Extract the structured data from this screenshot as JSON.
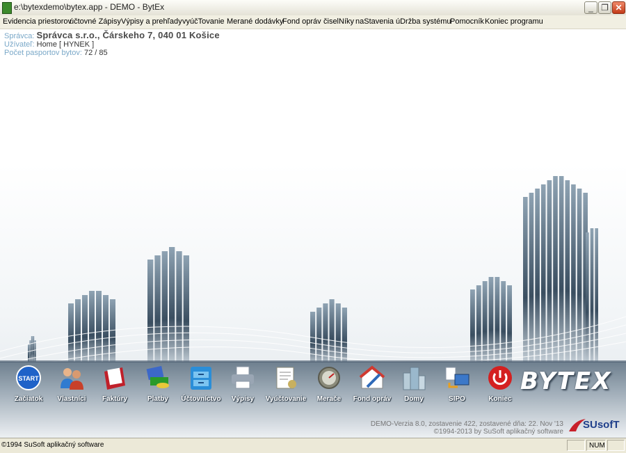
{
  "window": {
    "title": "e:\\bytexdemo\\bytex.app - DEMO - BytEx"
  },
  "menu": [
    "Evidencia priestorov",
    "účtovné Zápisy",
    "Výpisy a prehľady",
    "vyúčTovanie",
    "Merané dodávky",
    "Fond opráv",
    "čiselNíky",
    "naStavenia",
    "úDržba systému",
    "Pomocník",
    "Koniec programu"
  ],
  "info": {
    "spravca_label": "Správca:",
    "spravca_value": "Správca s.r.o., Čárskeho 7, 040 01  Košice",
    "uzivatel_label": "Užívateľ:",
    "uzivatel_value": "Home [ HYNEK ]",
    "pasporty_label": "Počet pasportov bytov:",
    "pasporty_value": "72 / 85"
  },
  "toolbar": [
    {
      "label": "Začiatok",
      "icon": "start-icon",
      "color": "#1f62c8"
    },
    {
      "label": "Vlastníci",
      "icon": "owners-icon",
      "color": "#2f7bd0"
    },
    {
      "label": "Faktúry",
      "icon": "invoices-icon",
      "color": "#c0202a"
    },
    {
      "label": "Platby",
      "icon": "payments-icon",
      "color": "#2a9a2a"
    },
    {
      "label": "Účtovníctvo",
      "icon": "accounting-icon",
      "color": "#2a8ed8"
    },
    {
      "label": "Výpisy",
      "icon": "printer-icon",
      "color": "#9aa6b4"
    },
    {
      "label": "Vyúčtovanie",
      "icon": "billing-icon",
      "color": "#c8b060"
    },
    {
      "label": "Merače",
      "icon": "meters-icon",
      "color": "#8a8a7a"
    },
    {
      "label": "Fond opráv",
      "icon": "repair-fund-icon",
      "color": "#d03a30"
    },
    {
      "label": "Domy",
      "icon": "houses-icon",
      "color": "#9ab8cc"
    },
    {
      "label": "SIPO",
      "icon": "sipo-icon",
      "color": "#3c78c8"
    },
    {
      "label": "Koniec",
      "icon": "power-icon",
      "color": "#d42020"
    }
  ],
  "logo": "BYTEX",
  "version": {
    "line1": "DEMO-Verzia 8.0, zostavenie 422, zostavené dňa:  22. Nov '13",
    "line2": "©1994-2013 by SuSoft aplikačný software"
  },
  "susoft_logo": "SUsofT",
  "status": {
    "text": "©1994 SuSoft aplikačný software",
    "num": "NUM"
  }
}
